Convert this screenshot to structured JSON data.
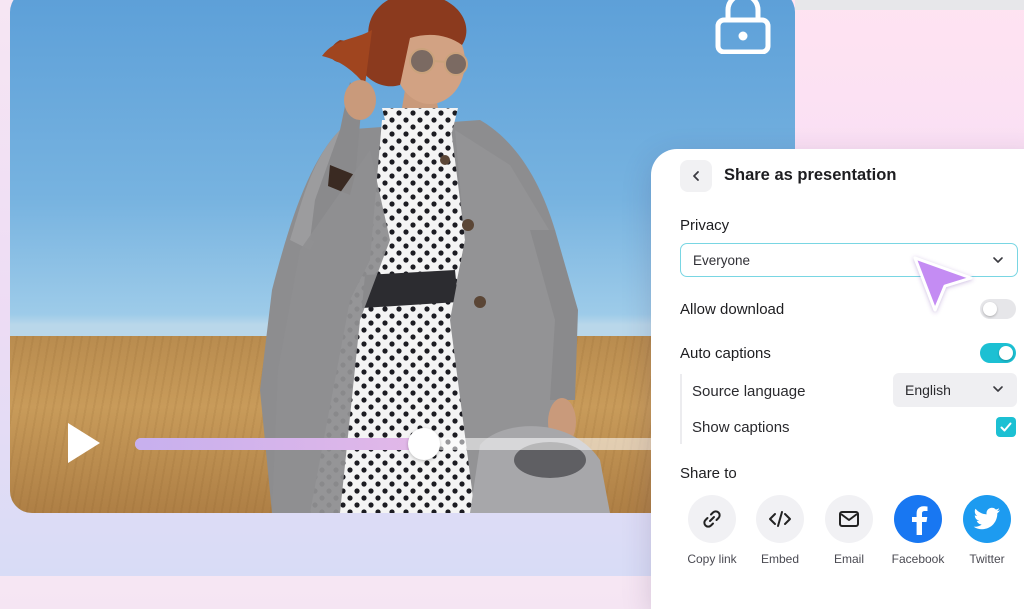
{
  "video": {
    "playing": false,
    "progress_fraction": 0.55
  },
  "share_panel": {
    "title": "Share as presentation",
    "privacy": {
      "label": "Privacy",
      "selected": "Everyone"
    },
    "allow_download": {
      "label": "Allow download",
      "enabled": false
    },
    "auto_captions": {
      "label": "Auto captions",
      "enabled": true,
      "source_language": {
        "label": "Source language",
        "selected": "English"
      },
      "show_captions": {
        "label": "Show captions",
        "checked": true
      }
    },
    "share_to": {
      "label": "Share to",
      "options": [
        {
          "label": "Copy link",
          "icon": "link-icon"
        },
        {
          "label": "Embed",
          "icon": "code-icon"
        },
        {
          "label": "Email",
          "icon": "envelope-icon"
        },
        {
          "label": "Facebook",
          "icon": "facebook-icon"
        },
        {
          "label": "Twitter",
          "icon": "twitter-icon"
        }
      ]
    }
  },
  "colors": {
    "accent": "#1cc0d3",
    "cursor": "#c48cf3",
    "facebook": "#1877f2",
    "twitter": "#1d9bf0"
  }
}
